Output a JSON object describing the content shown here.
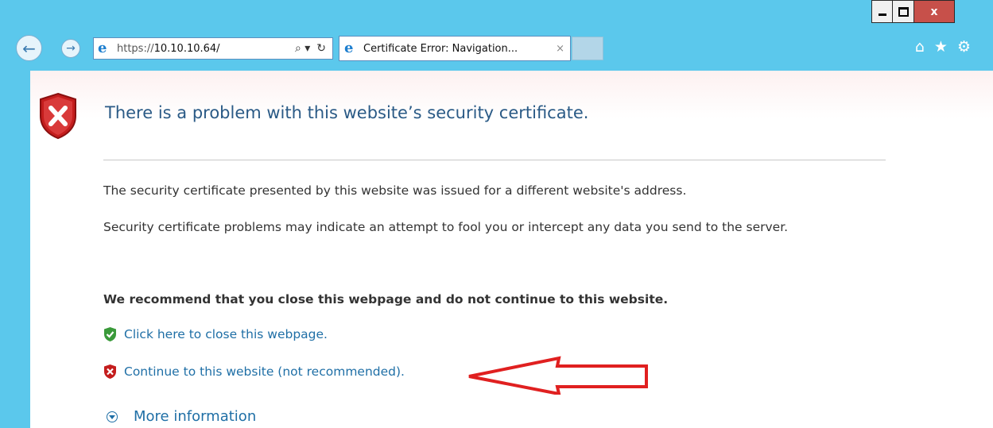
{
  "browser": {
    "address_bar": {
      "url_scheme": "https://",
      "url_host": "10.10.10.64/",
      "search_glyph": "⌕ ▾",
      "refresh_glyph": "↻"
    },
    "tab": {
      "title": "Certificate Error: Navigation...",
      "close_glyph": "×"
    },
    "caption": {
      "close_glyph": "x"
    },
    "icons": [
      "back-icon",
      "forward-icon",
      "ie-icon",
      "search-icon",
      "refresh-icon",
      "home-icon",
      "favorites-icon",
      "tools-icon"
    ]
  },
  "page": {
    "title": "There is a problem with this website’s security certificate.",
    "paragraph1": "The security certificate presented by this website was issued for a different website's address.",
    "paragraph2": "Security certificate problems may indicate an attempt to fool you or intercept any data you send to the server.",
    "recommendation": "We recommend that you close this webpage and do not continue to this website.",
    "close_link": "Click here to close this webpage.",
    "continue_link": "Continue to this website (not recommended).",
    "more_info": "More information"
  },
  "colors": {
    "window_frame": "#5bc8ec",
    "link": "#1f6fa6",
    "title": "#2a5a86",
    "annotation_arrow": "#e02020"
  }
}
